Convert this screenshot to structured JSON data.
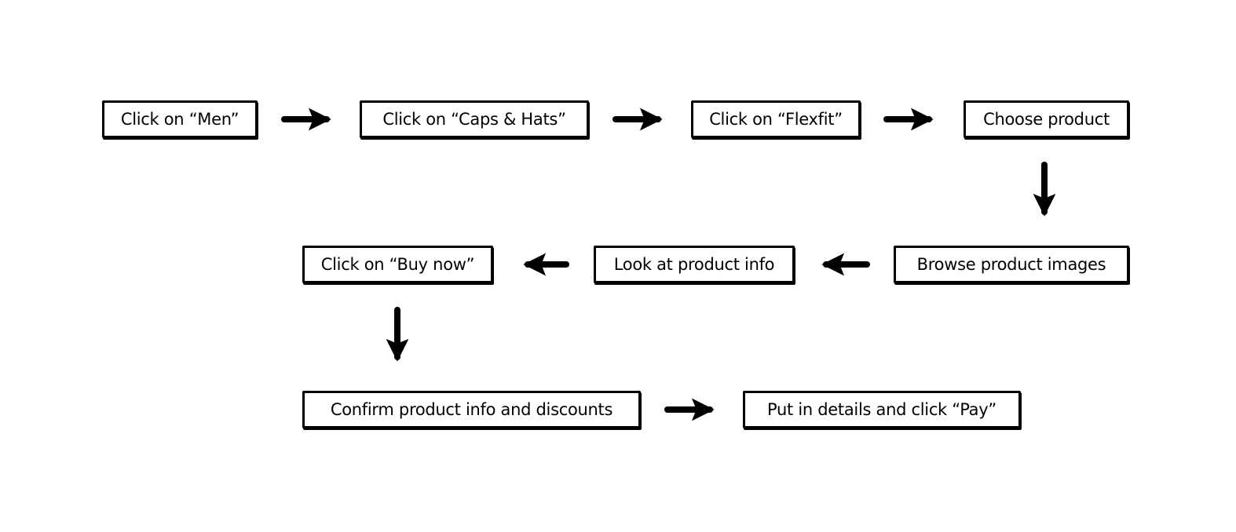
{
  "steps": [
    {
      "id": "men",
      "label": "Click on “Men”"
    },
    {
      "id": "caps",
      "label": "Click on “Caps & Hats”"
    },
    {
      "id": "flexfit",
      "label": "Click on “Flexfit”"
    },
    {
      "id": "choose",
      "label": "Choose product"
    },
    {
      "id": "browse",
      "label": "Browse product images"
    },
    {
      "id": "info",
      "label": "Look at product info"
    },
    {
      "id": "buy",
      "label": "Click on “Buy now”"
    },
    {
      "id": "confirm",
      "label": "Confirm product info and discounts"
    },
    {
      "id": "pay",
      "label": "Put in details and click “Pay”"
    }
  ],
  "colors": {
    "stroke": "#000000",
    "background": "#ffffff"
  }
}
